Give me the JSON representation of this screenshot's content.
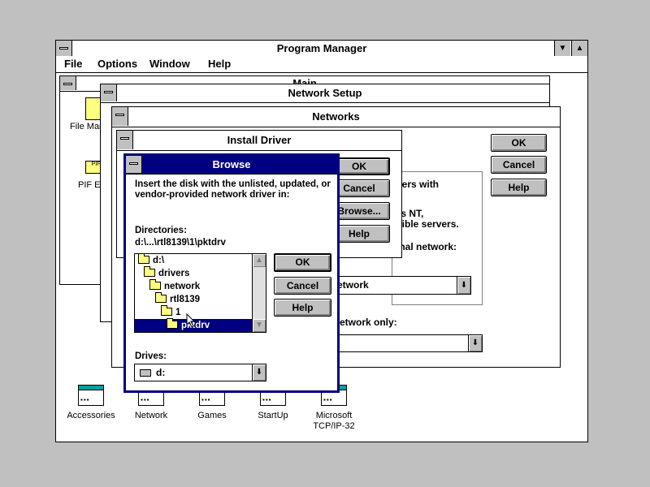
{
  "program_manager": {
    "title": "Program Manager",
    "menu": [
      "File",
      "Options",
      "Window",
      "Help"
    ],
    "groups": [
      {
        "label": "Accessories"
      },
      {
        "label": "Network"
      },
      {
        "label": "Games"
      },
      {
        "label": "StartUp"
      },
      {
        "label": "Microsoft\nTCP/IP-32"
      }
    ],
    "main_group": {
      "title": "Main",
      "items": [
        "File Manager",
        "PIF Editor"
      ]
    }
  },
  "network_setup": {
    "title": "Network Setup"
  },
  "networks_dialog": {
    "title": "Networks",
    "ok": "OK",
    "cancel": "Cancel",
    "help": "Help",
    "text_line1": "aters with",
    "text_line2": "ws NT,",
    "text_line3": "atible servers.",
    "text_line4": "onal network:",
    "network_select": "etwork",
    "network_only_label": "etwork only:"
  },
  "install_driver": {
    "title": "Install Driver",
    "ok": "OK",
    "cancel": "Cancel",
    "browse": "Browse...",
    "help": "Help"
  },
  "browse": {
    "title": "Browse",
    "prompt": "Insert the disk with the unlisted, updated, or vendor-provided network driver in:",
    "directories_label": "Directories:",
    "current_path": "d:\\...\\rtl8139\\1\\pktdrv",
    "tree": [
      {
        "name": "d:\\",
        "level": 0
      },
      {
        "name": "drivers",
        "level": 1
      },
      {
        "name": "network",
        "level": 2
      },
      {
        "name": "rtl8139",
        "level": 3
      },
      {
        "name": "1",
        "level": 4
      },
      {
        "name": "pktdrv",
        "level": 5,
        "selected": true
      }
    ],
    "drives_label": "Drives:",
    "drive_value": "d:",
    "ok": "OK",
    "cancel": "Cancel",
    "help": "Help"
  },
  "colors": {
    "desktop": "#c0c0c0",
    "active_title": "#000080",
    "selection": "#000080"
  }
}
